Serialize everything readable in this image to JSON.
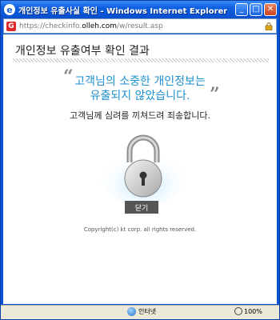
{
  "window": {
    "title": "개인정보 유출사실 확인 - Windows Internet Explorer",
    "buttons": {
      "minimize": "_",
      "maximize": "□",
      "close": "✕"
    }
  },
  "address_bar": {
    "scheme": "https://",
    "prefix": "checkinfo.",
    "host": "olleh.com",
    "path": "/w/result.asp"
  },
  "page": {
    "title": "개인정보 유출여부 확인 결과",
    "quote_open": "“",
    "quote_close": "”",
    "headline_line1": "고객님의 소중한 개인정보는",
    "headline_line2": "유출되지 않았습니다.",
    "apology": "고객님께 심려를 끼쳐드려 죄송합니다.",
    "close_button": "닫기",
    "copyright": "Copyright(c) kt corp. all rights reserved."
  },
  "status_bar": {
    "zone": "인터넷",
    "zoom": "100%"
  },
  "colors": {
    "headline": "#1e8fd0",
    "button_bg": "#555555"
  }
}
